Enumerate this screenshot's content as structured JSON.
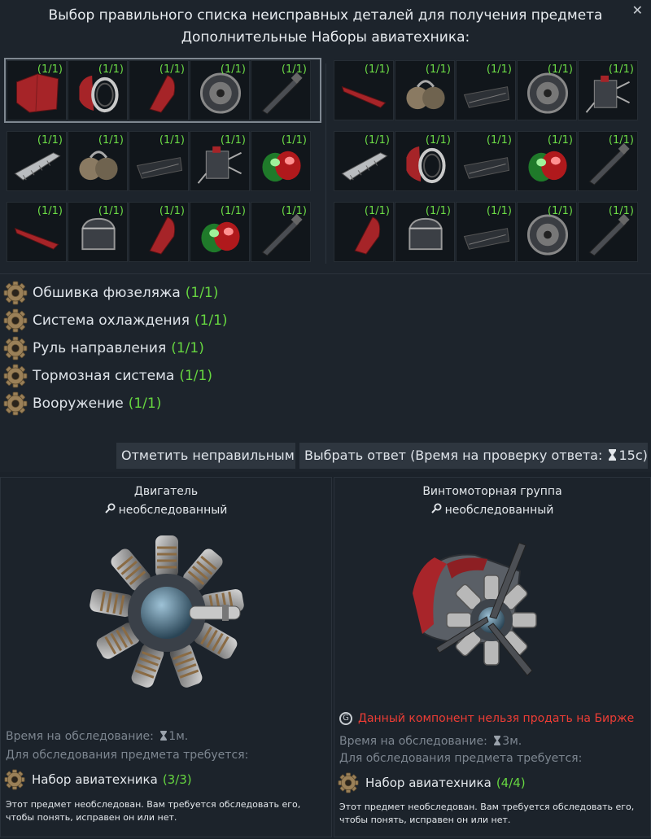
{
  "dialog": {
    "title": "Выбор правильного списка неисправных деталей для получения предмета",
    "subtitle": "Дополнительные Наборы авиатехника:",
    "close_glyph": "✕"
  },
  "sets": {
    "left": [
      [
        {
          "icon": "fuselage-skin-icon",
          "count": "(1/1)"
        },
        {
          "icon": "radiator-ring-icon",
          "count": "(1/1)"
        },
        {
          "icon": "rudder-icon",
          "count": "(1/1)"
        },
        {
          "icon": "brake-drum-icon",
          "count": "(1/1)"
        },
        {
          "icon": "gun-barrel-icon",
          "count": "(1/1)"
        }
      ],
      [
        {
          "icon": "wing-skin-icon",
          "count": "(1/1)"
        },
        {
          "icon": "oil-tank-icon",
          "count": "(1/1)"
        },
        {
          "icon": "airframe-spar-icon",
          "count": "(1/1)"
        },
        {
          "icon": "hydraulic-unit-icon",
          "count": "(1/1)"
        },
        {
          "icon": "navigation-lights-icon",
          "count": "(1/1)"
        }
      ],
      [
        {
          "icon": "wing-panel-icon",
          "count": "(1/1)"
        },
        {
          "icon": "cooling-unit-icon",
          "count": "(1/1)"
        },
        {
          "icon": "rudder-icon",
          "count": "(1/1)"
        },
        {
          "icon": "navigation-lights-icon",
          "count": "(1/1)"
        },
        {
          "icon": "gun-barrel-icon",
          "count": "(1/1)"
        }
      ]
    ],
    "right": [
      [
        {
          "icon": "wing-panel-icon",
          "count": "(1/1)"
        },
        {
          "icon": "oil-tank-icon",
          "count": "(1/1)"
        },
        {
          "icon": "airframe-spar-icon",
          "count": "(1/1)"
        },
        {
          "icon": "brake-drum-icon",
          "count": "(1/1)"
        },
        {
          "icon": "hydraulic-unit-icon",
          "count": "(1/1)"
        }
      ],
      [
        {
          "icon": "wing-skin-icon",
          "count": "(1/1)"
        },
        {
          "icon": "radiator-ring-icon",
          "count": "(1/1)"
        },
        {
          "icon": "airframe-spar-icon",
          "count": "(1/1)"
        },
        {
          "icon": "navigation-lights-icon",
          "count": "(1/1)"
        },
        {
          "icon": "gun-barrel-icon",
          "count": "(1/1)"
        }
      ],
      [
        {
          "icon": "rudder-icon",
          "count": "(1/1)"
        },
        {
          "icon": "cooling-unit-icon",
          "count": "(1/1)"
        },
        {
          "icon": "airframe-spar-icon",
          "count": "(1/1)"
        },
        {
          "icon": "brake-drum-icon",
          "count": "(1/1)"
        },
        {
          "icon": "gun-barrel-icon",
          "count": "(1/1)"
        }
      ]
    ]
  },
  "requirements": [
    {
      "label": "Обшивка фюзеляжа",
      "count": "(1/1)"
    },
    {
      "label": "Система охлаждения",
      "count": "(1/1)"
    },
    {
      "label": "Руль направления",
      "count": "(1/1)"
    },
    {
      "label": "Тормозная система",
      "count": "(1/1)"
    },
    {
      "label": "Вооружение",
      "count": "(1/1)"
    }
  ],
  "actions": {
    "mark_wrong": "Отметить неправильным",
    "choose_prefix": "Выбрать ответ (Время на проверку ответа:",
    "choose_time": "15с)"
  },
  "items": {
    "left": {
      "name": "Двигатель",
      "status": "необследованный",
      "time_label": "Время на обследование:",
      "time_value": "1м.",
      "requires_label": "Для обследования предмета требуется:",
      "kit_label": "Набор авиатехника",
      "kit_count": "(3/3)",
      "note_1": "Этот предмет необследован. Вам требуется обследовать его,",
      "note_2": "чтобы понять, исправен он или нет."
    },
    "right": {
      "name": "Винтомоторная группа",
      "status": "необследованный",
      "market_warning": "Данный компонент нельзя продать на Бирже",
      "time_label": "Время на обследование:",
      "time_value": "3м.",
      "requires_label": "Для обследования предмета требуется:",
      "kit_label": "Набор авиатехника",
      "kit_count": "(4/4)",
      "note_1": "Этот предмет необследован. Вам требуется обследовать его,",
      "note_2": "чтобы понять, исправен он или нет."
    }
  },
  "colors": {
    "count_green": "#66d640",
    "warning_red": "#ee3d35",
    "accent_red": "#b3262a"
  }
}
